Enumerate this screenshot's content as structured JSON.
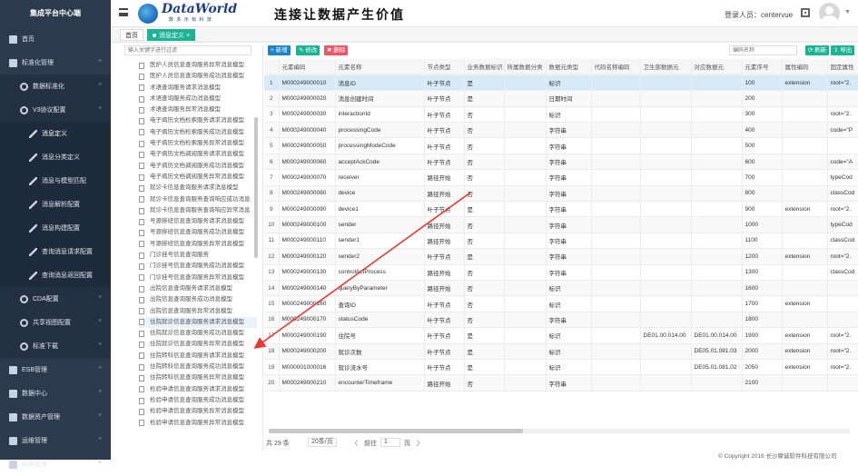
{
  "sidebar": {
    "title": "集成平台中心端",
    "items": [
      {
        "label": "首页",
        "level": 1,
        "icon": "home-icon",
        "arrow": ""
      },
      {
        "label": "标准化管理",
        "level": 1,
        "icon": "grid-icon",
        "arrow": "˄"
      },
      {
        "label": "数据标准化",
        "level": 2,
        "icon": "gear-icon",
        "arrow": "˅"
      },
      {
        "label": "V3协议配置",
        "level": 2,
        "icon": "gear-icon",
        "arrow": "˄"
      },
      {
        "label": "消息定义",
        "level": 3,
        "icon": "tool-icon",
        "arrow": "",
        "active": true
      },
      {
        "label": "消息分类定义",
        "level": 3,
        "icon": "tool-icon",
        "arrow": ""
      },
      {
        "label": "消息与模型匹配",
        "level": 3,
        "icon": "tool-icon",
        "arrow": ""
      },
      {
        "label": "消息解析配置",
        "level": 3,
        "icon": "tool-icon",
        "arrow": ""
      },
      {
        "label": "消息构建配置",
        "level": 3,
        "icon": "tool-icon",
        "arrow": ""
      },
      {
        "label": "查询消息请求配置",
        "level": 3,
        "icon": "tool-icon",
        "arrow": ""
      },
      {
        "label": "查询消息返回配置",
        "level": 3,
        "icon": "tool-icon",
        "arrow": ""
      },
      {
        "label": "CDA配置",
        "level": 2,
        "icon": "gear-icon",
        "arrow": "˅"
      },
      {
        "label": "共享视图配置",
        "level": 2,
        "icon": "gear-icon",
        "arrow": "˅"
      },
      {
        "label": "标准下载",
        "level": 2,
        "icon": "gear-icon",
        "arrow": "˅"
      },
      {
        "label": "ESB管理",
        "level": 1,
        "icon": "grid-icon",
        "arrow": "˅"
      },
      {
        "label": "数据中心",
        "level": 1,
        "icon": "grid-icon",
        "arrow": "˅"
      },
      {
        "label": "数据资产管理",
        "level": 1,
        "icon": "grid-icon",
        "arrow": "˅"
      },
      {
        "label": "运维管理",
        "level": 1,
        "icon": "grid-icon",
        "arrow": "˅"
      },
      {
        "label": "标准管理",
        "level": 1,
        "icon": "grid-icon",
        "arrow": "˅"
      }
    ]
  },
  "header": {
    "logo_text": "DataWorld",
    "logo_sub": "数 多 示 标 科 技",
    "slogan": "连接让数据产生价值",
    "user_label": "登录人员：centervue"
  },
  "tabs": {
    "home": "首页",
    "active": "消息定义"
  },
  "tree": {
    "search_placeholder": "输入关键字进行过滤",
    "nodes": [
      "医护人员信息查询服务异常消息模型",
      "医护人员信息查询服务成功消息模型",
      "术语查询服务请求消息模型",
      "术语查询服务成功消息模型",
      "术语查询服务异常消息模型",
      "电子病历文档检索服务请求消息模型",
      "电子病历文档检索服务成功消息模型",
      "电子病历文档检索服务异常消息模型",
      "电子病历文档调阅服务请求消息模型",
      "电子病历文档调阅服务成功消息模型",
      "电子病历文档调阅服务异常消息模型",
      "就诊卡信息查询服务请求消息模型",
      "就诊卡信息查询服务查询响应成功消息",
      "就诊卡信息查询服务查询响应异常消息",
      "号源排班信息查询服务请求消息模型",
      "号源排班信息查询服务成功消息模型",
      "号源排班信息查询服务异常消息模型",
      "门诊挂号信息查询服务",
      "门诊挂号信息查询服务成功消息模型",
      "门诊挂号信息查询服务异常消息模型",
      "出院信息查询服务请求消息模型",
      "出院信息查询服务成功消息模型",
      "出院信息查询服务异常消息模型",
      "住院就诊信息查询服务请求消息模型",
      "住院就诊信息查询服务成功消息模型",
      "住院就诊信息查询服务异常消息模型",
      "住院转科信息查询服务请求消息模型",
      "住院转科信息查询服务成功消息模型",
      "住院转科信息查询服务异常消息模型",
      "检验申请信息查询服务请求消息模型",
      "检验申请信息查询服务成功消息模型",
      "检验申请信息查询服务异常消息模型",
      "检验申请信息查询服务异常消息模型"
    ],
    "selected_index": 23
  },
  "toolbar": {
    "add": "+ 新增",
    "edit": "✎ 修改",
    "delete": "✖ 删除",
    "search_placeholder": "编码名称",
    "refresh": "刷新",
    "export": "导出"
  },
  "table": {
    "columns": [
      "",
      "元素编码",
      "元素名称",
      "节点类型",
      "业务数据标识",
      "所属数据分类",
      "数据元类型",
      "代码名称编码",
      "卫生部数据元",
      "对应数据元",
      "元素序号",
      "属性编码",
      "固定属性"
    ],
    "rows": [
      [
        "1",
        "M000249000010",
        "消息ID",
        "叶子节点",
        "是",
        "",
        "标识",
        "",
        "",
        "",
        "100",
        "extension",
        "root=\"2."
      ],
      [
        "2",
        "M000249000020",
        "消息创建时间",
        "叶子节点",
        "是",
        "",
        "日期时间",
        "",
        "",
        "",
        "200",
        "",
        ""
      ],
      [
        "3",
        "M000249000030",
        "interactionId",
        "叶子节点",
        "否",
        "",
        "标识",
        "",
        "",
        "",
        "300",
        "",
        "root=\"2."
      ],
      [
        "4",
        "M000249000040",
        "processingCode",
        "叶子节点",
        "否",
        "",
        "字符串",
        "",
        "",
        "",
        "400",
        "",
        "code=\"P"
      ],
      [
        "5",
        "M000249000050",
        "processingModeCode",
        "叶子节点",
        "否",
        "",
        "字符串",
        "",
        "",
        "",
        "500",
        "",
        ""
      ],
      [
        "6",
        "M000249000060",
        "acceptAckCode",
        "叶子节点",
        "否",
        "",
        "字符串",
        "",
        "",
        "",
        "600",
        "",
        "code=\"A"
      ],
      [
        "7",
        "M000249000070",
        "receiver",
        "路径开始",
        "否",
        "",
        "字符串",
        "",
        "",
        "",
        "700",
        "",
        "typeCod"
      ],
      [
        "8",
        "M000249000080",
        "device",
        "路径开始",
        "否",
        "",
        "字符串",
        "",
        "",
        "",
        "800",
        "",
        "classCod"
      ],
      [
        "9",
        "M000249000090",
        "device1",
        "叶子节点",
        "是",
        "",
        "字符串",
        "",
        "",
        "",
        "900",
        "extension",
        "root=\"2."
      ],
      [
        "10",
        "M000249000100",
        "sender",
        "路径开始",
        "否",
        "",
        "字符串",
        "",
        "",
        "",
        "1000",
        "",
        "typeCod"
      ],
      [
        "11",
        "M000249000110",
        "sender1",
        "路径开始",
        "否",
        "",
        "字符串",
        "",
        "",
        "",
        "1100",
        "",
        "classCod"
      ],
      [
        "12",
        "M000249000120",
        "sender2",
        "叶子节点",
        "是",
        "",
        "字符串",
        "",
        "",
        "",
        "1200",
        "extension",
        "root=\"2."
      ],
      [
        "13",
        "M000249000130",
        "controlActProcess",
        "路径开始",
        "否",
        "",
        "字符串",
        "",
        "",
        "",
        "1300",
        "",
        "classCod"
      ],
      [
        "14",
        "M000249000140",
        "queryByParameter",
        "路径开始",
        "否",
        "",
        "标识",
        "",
        "",
        "",
        "1600",
        "",
        ""
      ],
      [
        "15",
        "M000249000160",
        "查询ID",
        "叶子节点",
        "否",
        "",
        "标识",
        "",
        "",
        "",
        "1700",
        "extension",
        ""
      ],
      [
        "16",
        "M000249000170",
        "statusCode",
        "叶子节点",
        "否",
        "",
        "字符串",
        "",
        "",
        "",
        "1800",
        "",
        ""
      ],
      [
        "17",
        "M000249000190",
        "住院号",
        "叶子节点",
        "是",
        "",
        "标识",
        "",
        "DE01.00.014.00",
        "DE01.00.014.00",
        "1900",
        "extension",
        "root=\"2."
      ],
      [
        "18",
        "M000249000200",
        "就诊次数",
        "叶子节点",
        "是",
        "",
        "标识",
        "",
        "",
        "DE05.01.081.03",
        "2000",
        "extension",
        "root=\"2."
      ],
      [
        "19",
        "M000001000016",
        "就诊流水号",
        "叶子节点",
        "是",
        "",
        "标识",
        "",
        "",
        "DE05.01.081.02",
        "2050",
        "extension",
        "root=\"2."
      ],
      [
        "20",
        "M000249000210",
        "encounterTimeframe",
        "路径开始",
        "否",
        "",
        "字符串",
        "",
        "",
        "",
        "2100",
        "",
        ""
      ]
    ],
    "selected_index": 0
  },
  "pager": {
    "total": "共 29 条",
    "page_size": "20条/页",
    "prev": "〈",
    "goto_label": "前往",
    "page": "1",
    "page_suffix": "页",
    "next": "〉"
  },
  "footer": "© Copyright 2016 长沙摩诚软件科技有限公司",
  "colors": {
    "sidebar": "#2b3a4d",
    "accent": "#1ab394",
    "primary": "#1c84c6",
    "danger": "#ed5565",
    "annotation": "#e53935"
  }
}
